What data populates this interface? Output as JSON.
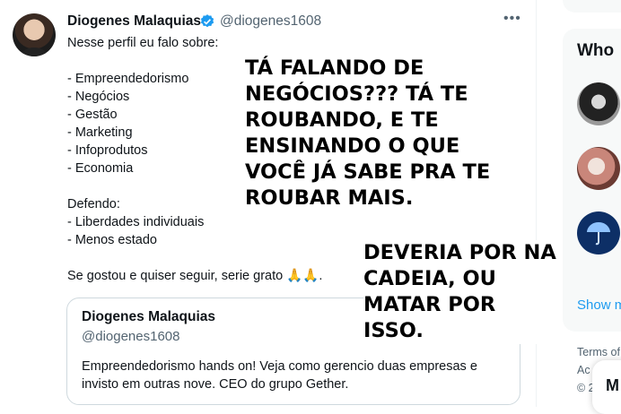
{
  "profile": {
    "name": "Diogenes Malaquias",
    "handle": "@diogenes1608",
    "bio_lines": [
      "Nesse perfil eu falo sobre:",
      "",
      "- Empreendedorismo",
      "- Negócios",
      "- Gestão",
      "- Marketing",
      "- Infoprodutos",
      "- Economia",
      "",
      "Defendo:",
      "- Liberdades individuais",
      "- Menos estado",
      "",
      "Se gostou e quiser seguir, serie grato 🙏🙏."
    ],
    "more_label": "•••"
  },
  "quote": {
    "name": "Diogenes Malaquias",
    "handle": "@diogenes1608",
    "text": "Empreendedorismo hands on! Veja como gerencio duas empresas e invisto em outras nove. CEO do grupo Gether."
  },
  "overlay": {
    "text1": [
      "TÁ FALANDO DE",
      "NEGÓCIOS??? TÁ TE",
      "ROUBANDO, E TE",
      "ENSINANDO O QUE",
      "VOCÊ JÁ SABE PRA TE",
      "ROUBAR MAIS."
    ],
    "text2": [
      "DEVERIA POR NA",
      "CADEIA, OU",
      "MATAR POR",
      "ISSO."
    ]
  },
  "sidebar": {
    "who_title": "Who",
    "show_more": "Show m",
    "footer": [
      "Terms of",
      "Ac",
      "© 2"
    ],
    "messages_label": "M"
  },
  "colors": {
    "accent": "#1d9bf0",
    "muted": "#536471"
  }
}
